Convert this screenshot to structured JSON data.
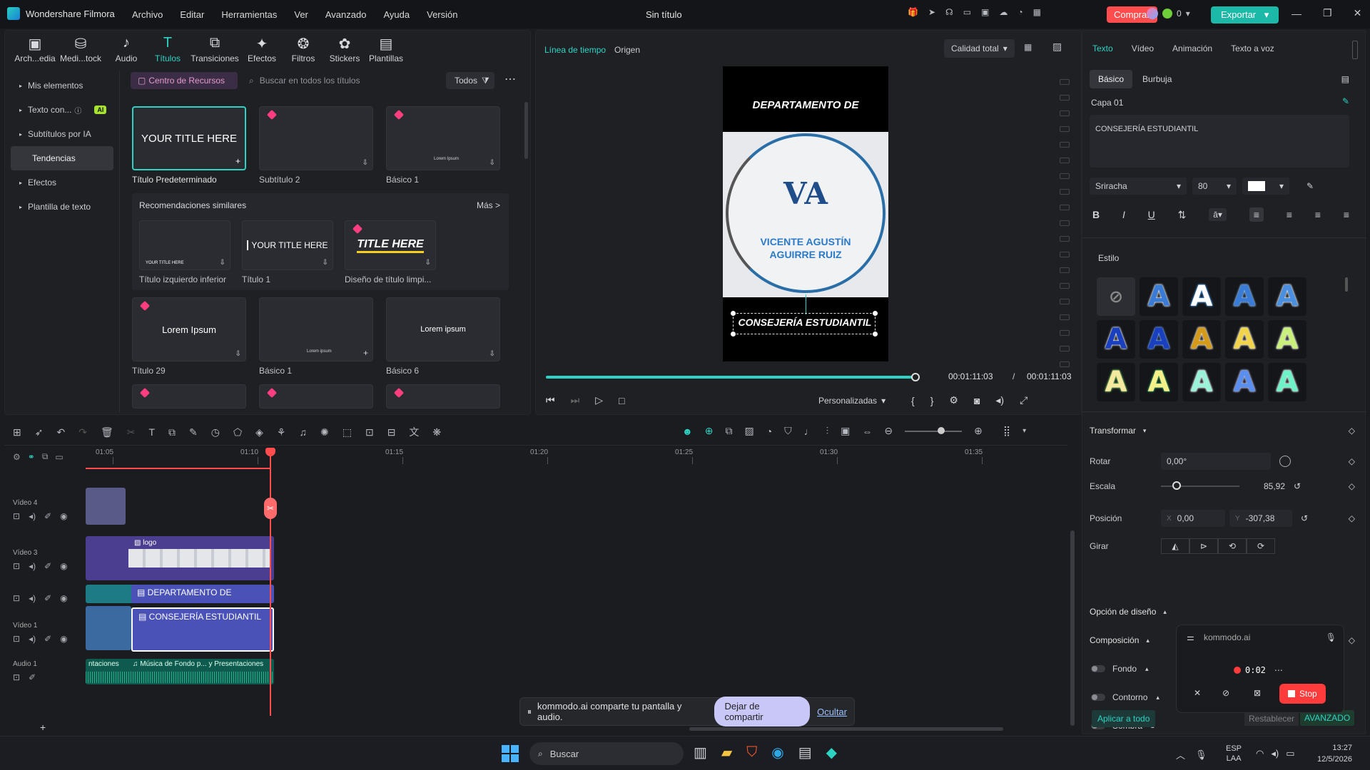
{
  "app": {
    "name": "Wondershare Filmora",
    "title": "Sin título",
    "menu": [
      "Archivo",
      "Editar",
      "Herramientas",
      "Ver",
      "Avanzado",
      "Ayuda",
      "Versión"
    ],
    "buy_label": "Comprar",
    "export_label": "Exportar",
    "credits": "0",
    "accent": "#2ed3c4"
  },
  "toolbar": {
    "items": [
      {
        "label": "Arch...edia",
        "icon": "media-icon"
      },
      {
        "label": "Medi...tock",
        "icon": "stock-icon"
      },
      {
        "label": "Audio",
        "icon": "audio-icon"
      },
      {
        "label": "Títulos",
        "icon": "titles-icon"
      },
      {
        "label": "Transiciones",
        "icon": "transitions-icon"
      },
      {
        "label": "Efectos",
        "icon": "effects-icon"
      },
      {
        "label": "Filtros",
        "icon": "filters-icon"
      },
      {
        "label": "Stickers",
        "icon": "stickers-icon"
      },
      {
        "label": "Plantillas",
        "icon": "templates-icon"
      }
    ]
  },
  "sidebar": {
    "items": [
      "Mis elementos",
      "Texto con...",
      "Subtítulos por IA",
      "Tendencias",
      "Efectos",
      "Plantilla de texto"
    ],
    "ai_badge": "AI"
  },
  "library": {
    "resource_center": "Centro de Recursos",
    "search_placeholder": "Buscar en todos los títulos",
    "filter_label": "Todos",
    "cards_row1": [
      {
        "label": "Título Predeterminado",
        "thumb": "YOUR TITLE HERE"
      },
      {
        "label": "Subtítulo 2",
        "thumb": ""
      },
      {
        "label": "Básico 1",
        "thumb": "Lorem Ipsum"
      }
    ],
    "recommend_title": "Recomendaciones similares",
    "more_label": "Más >",
    "rec_cards": [
      {
        "label": "Título izquierdo inferior",
        "thumb": "YOUR TITLE HERE"
      },
      {
        "label": "Título 1",
        "thumb": "YOUR TITLE HERE"
      },
      {
        "label": "Diseño de título limpi...",
        "thumb": "TITLE HERE"
      }
    ],
    "cards_row3": [
      {
        "label": "Título 29",
        "thumb": "Lorem Ipsum"
      },
      {
        "label": "Básico 1",
        "thumb": "Lorem ipsum"
      },
      {
        "label": "Básico 6",
        "thumb": "Lorem ipsum"
      }
    ]
  },
  "preview": {
    "tab_timeline": "Línea de tiempo",
    "tab_origin": "Origen",
    "quality": "Calidad total",
    "canvas_top_text": "DEPARTAMENTO DE",
    "logo_line1": "VICENTE AGUSTÍN",
    "logo_line2": "AGUIRRE RUIZ",
    "logo_letters": "VA",
    "canvas_bottom_text": "CONSEJERÍA ESTUDIANTIL",
    "current_time": "00:01:11:03",
    "separator": "/",
    "total_time": "00:01:11:03",
    "zoom_label": "Personalizadas",
    "progress": 1.0
  },
  "inspector": {
    "tabs": [
      "Texto",
      "Vídeo",
      "Animación",
      "Texto a voz"
    ],
    "subtabs": [
      "Básico",
      "Burbuja"
    ],
    "layer": "Capa 01",
    "text_value": "CONSEJERÍA ESTUDIANTIL",
    "font": "Sriracha",
    "font_size": "80",
    "text_color": "#ffffff",
    "style_title": "Estilo",
    "transform_title": "Transformar",
    "rotate_label": "Rotar",
    "rotate_value": "0,00°",
    "scale_label": "Escala",
    "scale_value": "85,92",
    "scale_fraction": 0.2,
    "position_label": "Posición",
    "pos_x_label": "X",
    "pos_x": "0,00",
    "pos_y_label": "Y",
    "pos_y": "-307,38",
    "flip_label": "Girar",
    "design_label": "Opción de diseño",
    "composition_label": "Composición",
    "background_label": "Fondo",
    "outline_label": "Contorno",
    "shadow_label": "Sombra",
    "apply_all": "Aplicar a todo",
    "reset": "Restablecer",
    "advanced": "AVANZADO"
  },
  "timeline": {
    "ruler": [
      "01:05",
      "01:10",
      "01:15",
      "01:20",
      "01:25",
      "01:30",
      "01:35"
    ],
    "tracks": [
      {
        "name": "Vídeo 4"
      },
      {
        "name": "Vídeo 3"
      },
      {
        "name": ""
      },
      {
        "name": "Vídeo 1"
      },
      {
        "name": "Audio 1"
      }
    ],
    "clips": {
      "logo": "logo",
      "dept": "DEPARTAMENTO DE",
      "consejeria": "CONSEJERÍA ESTUDIANTIL",
      "audio_left": "ntaciones",
      "audio": "Música de Fondo p... y Presentaciones"
    }
  },
  "share_bar": {
    "message": "kommodo.ai comparte tu pantalla y audio.",
    "stop_sharing": "Dejar de compartir",
    "hide": "Ocultar"
  },
  "recorder": {
    "app": "kommodo.ai",
    "time": "0:02",
    "stop": "Stop"
  },
  "taskbar": {
    "search": "Buscar",
    "lang1": "ESP",
    "lang2": "LAA",
    "time": "13:27",
    "date": "12/5/2026"
  }
}
